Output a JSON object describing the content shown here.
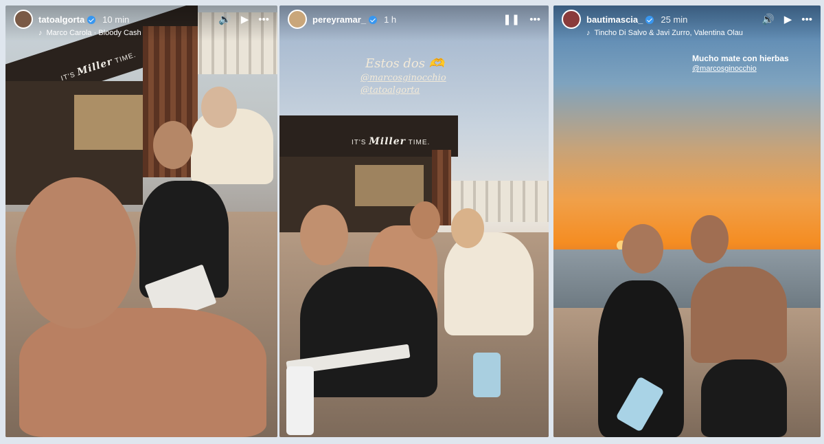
{
  "stories": [
    {
      "username": "tatoalgorta",
      "verified": true,
      "time": "10 min",
      "music": "Marco Carola · Bloody Cash",
      "controls": {
        "mute": "🔊",
        "play": "▶",
        "more": "•••"
      },
      "kiosk_text": {
        "its": "IT'S",
        "brand": "Miller",
        "time": "TIME."
      }
    },
    {
      "username": "pereyramar_",
      "verified": true,
      "time": "1 h",
      "controls": {
        "pause": "❚❚",
        "more": "•••"
      },
      "caption": "Estos dos 🫶",
      "mentions": [
        "@marcosginocchio",
        "@tatoalgorta"
      ],
      "kiosk_text": {
        "its": "IT'S",
        "brand": "Miller",
        "time": "TIME."
      }
    },
    {
      "username": "bautimascia_",
      "verified": true,
      "time": "25 min",
      "music": "Tincho Di Salvo & Javi Zurro, Valentina Olau",
      "controls": {
        "mute": "🔊",
        "play": "▶",
        "more": "•••"
      },
      "caption": "Mucho mate con hierbas",
      "mentions": [
        "@marcosginocchio"
      ]
    }
  ],
  "colors": {
    "verified": "#3897f0",
    "sunset": "#f58d22"
  }
}
